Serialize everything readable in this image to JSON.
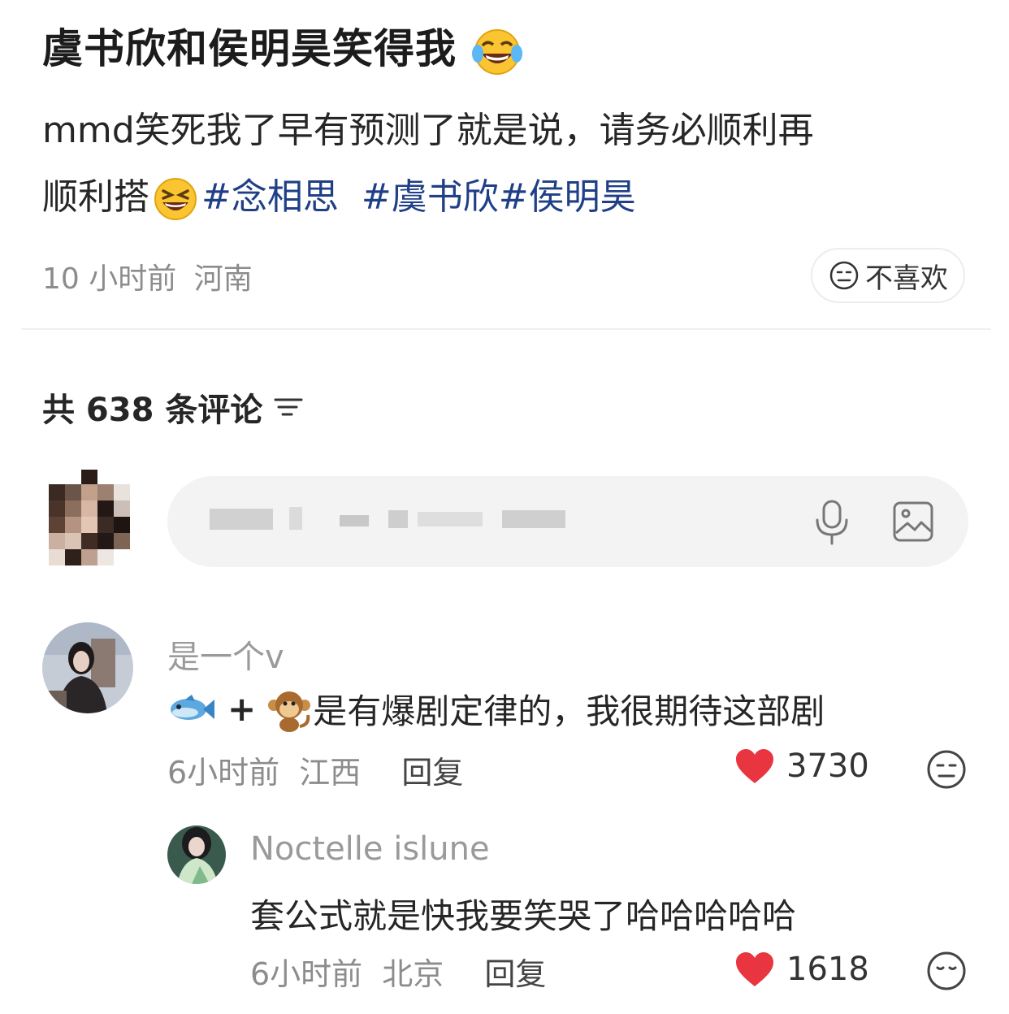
{
  "post": {
    "title": "虞书欣和侯明昊笑得我",
    "title_emoji": "laughing-tears-emoji",
    "body_line1": "mmd笑死我了早有预测了就是说，请务必顺利再",
    "body_line2_prefix": "顺利搭",
    "body_emoji": "grinning-squint-emoji",
    "hashtags": [
      "#念相思",
      "#虞书欣",
      "#侯明昊"
    ],
    "time": "10 小时前",
    "location": "河南",
    "dislike_label": "不喜欢"
  },
  "comments_header": {
    "label": "共 638 条评论"
  },
  "comment_input": {
    "icons": [
      "mic-icon",
      "image-icon"
    ]
  },
  "comments": [
    {
      "user": "是一个v",
      "text": "是有爆剧定律的，我很期待这部剧",
      "text_prefix_icons": [
        "fish-emoji",
        "plus",
        "monkey-emoji"
      ],
      "time": "6小时前",
      "location": "江西",
      "reply_label": "回复",
      "likes": "3730"
    },
    {
      "user": "Noctelle islune",
      "text": "套公式就是快我要笑哭了哈哈哈哈哈",
      "time": "6小时前",
      "location": "北京",
      "reply_label": "回复",
      "likes": "1618"
    }
  ],
  "colors": {
    "hashtag": "#1f3f86",
    "like_heart": "#e9353f",
    "meta_text": "#8c8c8c"
  }
}
